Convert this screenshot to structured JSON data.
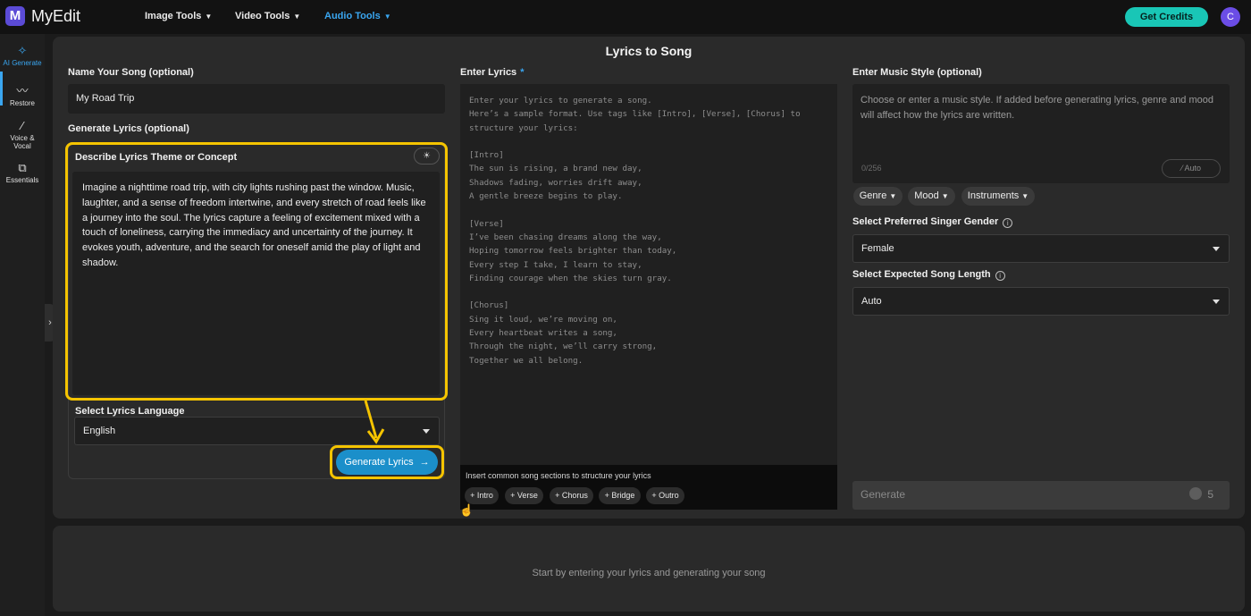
{
  "app": {
    "brand": "MyEdit",
    "logo_letter": "M"
  },
  "nav": {
    "items": [
      {
        "label": "Image Tools"
      },
      {
        "label": "Video Tools"
      },
      {
        "label": "Audio Tools",
        "active": true
      }
    ],
    "credits_label": "Get Credits",
    "avatar_letter": "C"
  },
  "sidebar": {
    "items": [
      {
        "label": "AI Generate",
        "icon": "magic-wand-icon",
        "active": true
      },
      {
        "label": "Restore",
        "icon": "waveform-icon"
      },
      {
        "label": "Voice & Vocal",
        "icon": "wand-icon"
      },
      {
        "label": "Essentials",
        "icon": "layers-icon"
      }
    ]
  },
  "page": {
    "title": "Lyrics to Song"
  },
  "left": {
    "name_label": "Name Your Song (optional)",
    "name_value": "My Road Trip",
    "gen_lyrics_label": "Generate Lyrics (optional)",
    "theme_label": "Describe Lyrics Theme or Concept",
    "theme_text": "Imagine a nighttime road trip, with city lights rushing past the window. Music, laughter, and a sense of freedom intertwine, and every stretch of road feels like a journey into the soul. The lyrics capture a feeling of excitement mixed with a touch of loneliness, carrying the immediacy and uncertainty of the journey. It evokes youth, adventure, and the search for oneself amid the play of light and shadow.",
    "language_label": "Select Lyrics Language",
    "language_value": "English",
    "generate_button": "Generate Lyrics",
    "generate_arrow": "→"
  },
  "middle": {
    "lyrics_label": "Enter Lyrics",
    "required_mark": "*",
    "lyrics_placeholder": "Enter your lyrics to generate a song.\nHere’s a sample format. Use tags like [Intro], [Verse], [Chorus] to\nstructure your lyrics:\n\n[Intro]\nThe sun is rising, a brand new day,\nShadows fading, worries drift away,\nA gentle breeze begins to play.\n\n[Verse]\nI’ve been chasing dreams along the way,\nHoping tomorrow feels brighter than today,\nEvery step I take, I learn to stay,\nFinding courage when the skies turn gray.\n\n[Chorus]\nSing it loud, we’re moving on,\nEvery heartbeat writes a song,\nThrough the night, we’ll carry strong,\nTogether we all belong.",
    "sections_hint": "Insert common song sections to structure your lyrics",
    "sections": [
      "+ Intro",
      "+ Verse",
      "+ Chorus",
      "+ Bridge",
      "+ Outro"
    ]
  },
  "right": {
    "style_label": "Enter Music Style (optional)",
    "style_placeholder": "Choose or enter a music style. If added before generating lyrics, genre and mood will affect how the lyrics are written.",
    "counter": "0/256",
    "auto_label": "Auto",
    "filters": [
      "Genre",
      "Mood",
      "Instruments"
    ],
    "gender_label": "Select Preferred Singer Gender",
    "gender_value": "Female",
    "length_label": "Select Expected Song Length",
    "length_value": "Auto",
    "generate_label": "Generate",
    "generate_cost": "5"
  },
  "bottom": {
    "hint": "Start by entering your lyrics and generating your song"
  },
  "colors": {
    "accent": "#3aa6f0",
    "highlight": "#f5c400",
    "credits": "#19c6b6",
    "button": "#1b8fca"
  }
}
